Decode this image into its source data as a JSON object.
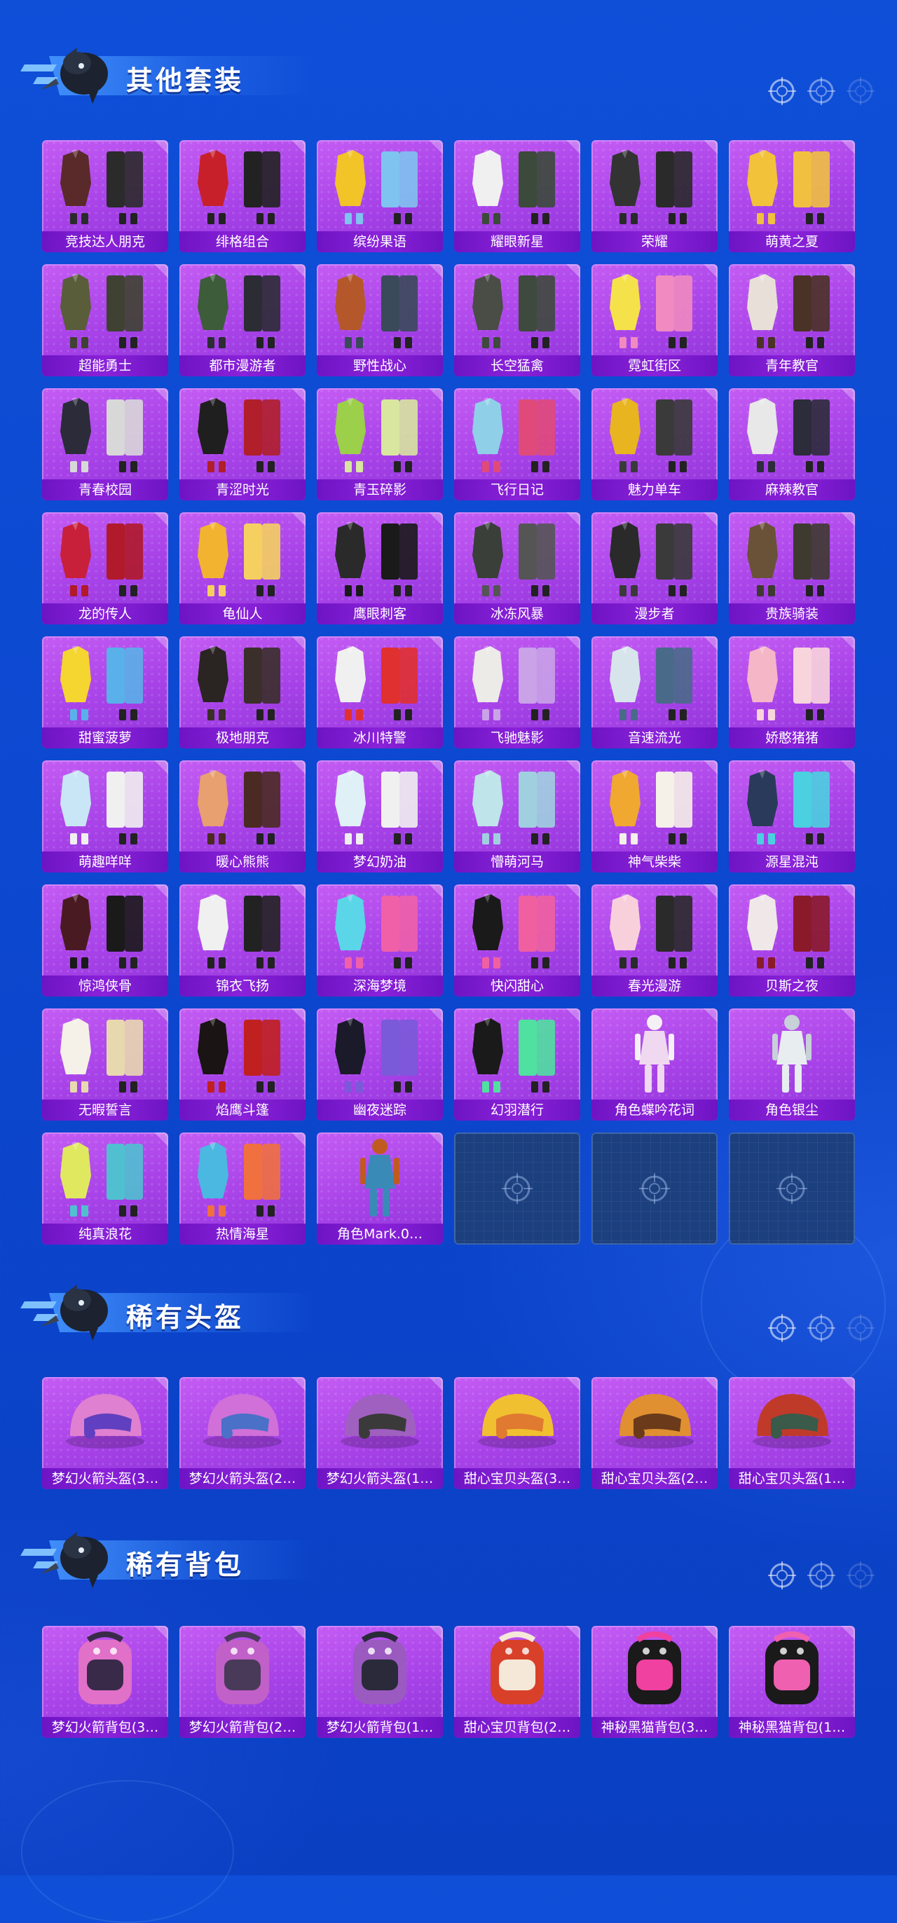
{
  "sections": [
    {
      "title": "其他套装",
      "items": [
        {
          "label": "竞技达人朋克",
          "kind": "outfit",
          "c1": "#5a2a2a",
          "c2": "#2b2b2b"
        },
        {
          "label": "绯格组合",
          "kind": "outfit",
          "c1": "#c8202a",
          "c2": "#222222"
        },
        {
          "label": "缤纷果语",
          "kind": "outfit",
          "c1": "#f2c427",
          "c2": "#7fc3f0"
        },
        {
          "label": "耀眼新星",
          "kind": "outfit",
          "c1": "#f0f0f0",
          "c2": "#3b4a3a"
        },
        {
          "label": "荣耀",
          "kind": "outfit",
          "c1": "#333333",
          "c2": "#2a2a2a"
        },
        {
          "label": "萌黄之夏",
          "kind": "outfit",
          "c1": "#f2c23a",
          "c2": "#f0c040"
        },
        {
          "label": "超能勇士",
          "kind": "outfit",
          "c1": "#5a5d3a",
          "c2": "#3f4232"
        },
        {
          "label": "都市漫游者",
          "kind": "outfit",
          "c1": "#3d5c3a",
          "c2": "#2c2c35"
        },
        {
          "label": "野性战心",
          "kind": "outfit",
          "c1": "#b4582c",
          "c2": "#3a4a5a"
        },
        {
          "label": "长空猛禽",
          "kind": "outfit",
          "c1": "#4a4d46",
          "c2": "#3e4a3d"
        },
        {
          "label": "霓虹街区",
          "kind": "outfit",
          "c1": "#f5e24a",
          "c2": "#f08ac0"
        },
        {
          "label": "青年教官",
          "kind": "outfit",
          "c1": "#e8e0d8",
          "c2": "#4a3226"
        },
        {
          "label": "青春校园",
          "kind": "outfit",
          "c1": "#2b2b3a",
          "c2": "#d8d8d8"
        },
        {
          "label": "青涩时光",
          "kind": "outfit",
          "c1": "#1f1f1f",
          "c2": "#b01f2a"
        },
        {
          "label": "青玉碎影",
          "kind": "outfit",
          "c1": "#9ccf4a",
          "c2": "#d8e6a0"
        },
        {
          "label": "飞行日记",
          "kind": "outfit",
          "c1": "#8fd0e8",
          "c2": "#e04a7a"
        },
        {
          "label": "魅力单车",
          "kind": "outfit",
          "c1": "#e8b420",
          "c2": "#3a3a3a"
        },
        {
          "label": "麻辣教官",
          "kind": "outfit",
          "c1": "#e8e8e8",
          "c2": "#2c2c3a"
        },
        {
          "label": "龙的传人",
          "kind": "outfit",
          "c1": "#c8203a",
          "c2": "#b01a2a"
        },
        {
          "label": "龟仙人",
          "kind": "outfit",
          "c1": "#f2b430",
          "c2": "#f5d060"
        },
        {
          "label": "鹰眼刺客",
          "kind": "outfit",
          "c1": "#2a2a2a",
          "c2": "#1a1a1a"
        },
        {
          "label": "冰冻风暴",
          "kind": "outfit",
          "c1": "#3a3f3a",
          "c2": "#555555"
        },
        {
          "label": "漫步者",
          "kind": "outfit",
          "c1": "#2a2a2a",
          "c2": "#3a3a3a"
        },
        {
          "label": "贵族骑装",
          "kind": "outfit",
          "c1": "#6a5238",
          "c2": "#3e3a30"
        },
        {
          "label": "甜蜜菠萝",
          "kind": "outfit",
          "c1": "#f5d530",
          "c2": "#5ab0e8"
        },
        {
          "label": "极地朋克",
          "kind": "outfit",
          "c1": "#2a2422",
          "c2": "#3a2f2a"
        },
        {
          "label": "冰川特警",
          "kind": "outfit",
          "c1": "#f0f0f0",
          "c2": "#e03030"
        },
        {
          "label": "飞驰魅影",
          "kind": "outfit",
          "c1": "#ecebe8",
          "c2": "#c9a2e8"
        },
        {
          "label": "音速流光",
          "kind": "outfit",
          "c1": "#d8e4ec",
          "c2": "#4a6a8a"
        },
        {
          "label": "娇憨猪猪",
          "kind": "outfit",
          "c1": "#f5b6c8",
          "c2": "#f8d4dc"
        },
        {
          "label": "萌趣咩咩",
          "kind": "outfit",
          "c1": "#c8e6f5",
          "c2": "#f0f0f0"
        },
        {
          "label": "暖心熊熊",
          "kind": "outfit",
          "c1": "#e8a070",
          "c2": "#4a2a22"
        },
        {
          "label": "梦幻奶油",
          "kind": "outfit",
          "c1": "#dff0f6",
          "c2": "#f0f0f0"
        },
        {
          "label": "懵萌河马",
          "kind": "outfit",
          "c1": "#bfe4ea",
          "c2": "#a0d0e0"
        },
        {
          "label": "神气柴柴",
          "kind": "outfit",
          "c1": "#f0a830",
          "c2": "#f5f0e8"
        },
        {
          "label": "源星混沌",
          "kind": "outfit",
          "c1": "#2a3a5a",
          "c2": "#4ad0e0"
        },
        {
          "label": "惊鸿侠骨",
          "kind": "outfit",
          "c1": "#4a1a22",
          "c2": "#1a1a1a"
        },
        {
          "label": "锦衣飞扬",
          "kind": "outfit",
          "c1": "#f0f0f0",
          "c2": "#222222"
        },
        {
          "label": "深海梦境",
          "kind": "outfit",
          "c1": "#5ad6e8",
          "c2": "#f060a8"
        },
        {
          "label": "快闪甜心",
          "kind": "outfit",
          "c1": "#1a1a1a",
          "c2": "#f060a0"
        },
        {
          "label": "春光漫游",
          "kind": "outfit",
          "c1": "#f8d0dc",
          "c2": "#2a2a2a"
        },
        {
          "label": "贝斯之夜",
          "kind": "outfit",
          "c1": "#f0e8e8",
          "c2": "#8a1a2a"
        },
        {
          "label": "无暇誓言",
          "kind": "outfit",
          "c1": "#f5f0e8",
          "c2": "#e8d8b0"
        },
        {
          "label": "焰鹰斗篷",
          "kind": "outfit",
          "c1": "#1a1414",
          "c2": "#c02020"
        },
        {
          "label": "幽夜迷踪",
          "kind": "outfit",
          "c1": "#1a1a2a",
          "c2": "#7a5ad8"
        },
        {
          "label": "幻羽潜行",
          "kind": "outfit",
          "c1": "#1a1a1a",
          "c2": "#50e0a0"
        },
        {
          "label": "角色蝶吟花词",
          "kind": "figure",
          "c1": "#f0d8f0",
          "c2": "#f5f0f5"
        },
        {
          "label": "角色银尘",
          "kind": "figure",
          "c1": "#e8eef0",
          "c2": "#c8d0d8"
        },
        {
          "label": "纯真浪花",
          "kind": "outfit",
          "c1": "#e0e860",
          "c2": "#50c0d0"
        },
        {
          "label": "热情海星",
          "kind": "outfit",
          "c1": "#4ab8e0",
          "c2": "#f07040"
        },
        {
          "label": "角色Mark.0…",
          "kind": "figure",
          "c1": "#3a8ab8",
          "c2": "#c05a20"
        },
        {
          "label": "",
          "kind": "empty"
        },
        {
          "label": "",
          "kind": "empty"
        },
        {
          "label": "",
          "kind": "empty"
        }
      ]
    },
    {
      "title": "稀有头盔",
      "items": [
        {
          "label": "梦幻火箭头盔(3…",
          "kind": "helmet",
          "c1": "#e080d0",
          "c2": "#6040c0"
        },
        {
          "label": "梦幻火箭头盔(2…",
          "kind": "helmet",
          "c1": "#d070d8",
          "c2": "#4a70c8"
        },
        {
          "label": "梦幻火箭头盔(1…",
          "kind": "helmet",
          "c1": "#a060c0",
          "c2": "#3a3a3a"
        },
        {
          "label": "甜心宝贝头盔(3…",
          "kind": "helmet",
          "c1": "#f0c030",
          "c2": "#e07a30"
        },
        {
          "label": "甜心宝贝头盔(2…",
          "kind": "helmet",
          "c1": "#e09030",
          "c2": "#6a3a1a"
        },
        {
          "label": "甜心宝贝头盔(1…",
          "kind": "helmet",
          "c1": "#c03a2a",
          "c2": "#3a5a4a"
        }
      ]
    },
    {
      "title": "稀有背包",
      "items": [
        {
          "label": "梦幻火箭背包(3…",
          "kind": "backpack",
          "c1": "#e070c8",
          "c2": "#3a2a4a"
        },
        {
          "label": "梦幻火箭背包(2…",
          "kind": "backpack",
          "c1": "#c060c8",
          "c2": "#4a3a5a"
        },
        {
          "label": "梦幻火箭背包(1…",
          "kind": "backpack",
          "c1": "#9a5ac0",
          "c2": "#2a2a3a"
        },
        {
          "label": "甜心宝贝背包(2…",
          "kind": "backpack",
          "c1": "#d8402a",
          "c2": "#f5e8d8"
        },
        {
          "label": "神秘黑猫背包(3…",
          "kind": "backpack",
          "c1": "#1a1a1a",
          "c2": "#f040a0"
        },
        {
          "label": "神秘黑猫背包(1…",
          "kind": "backpack",
          "c1": "#1a1a1a",
          "c2": "#f060b0"
        }
      ]
    }
  ],
  "colors": {
    "accent": "#7fc0ff",
    "card_label_bg": "#7a1ccf",
    "card_bg": "#b04aee",
    "empty_bg": "#1c3f7e"
  }
}
